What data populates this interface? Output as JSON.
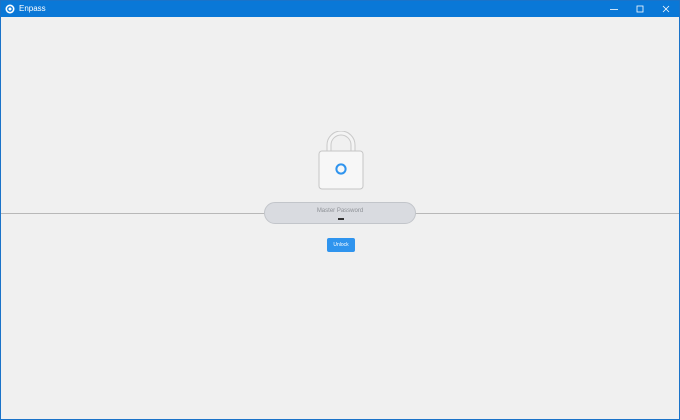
{
  "window": {
    "title": "Enpass",
    "controls": {
      "minimize": "minimize-icon",
      "maximize": "maximize-icon",
      "close": "close-icon"
    }
  },
  "lock_screen": {
    "password_placeholder": "Master Password",
    "unlock_label": "Unlock"
  },
  "colors": {
    "titlebar": "#0a78d7",
    "accent": "#2f94ee",
    "background": "#f0f0f0",
    "field": "#d9dbe0"
  }
}
